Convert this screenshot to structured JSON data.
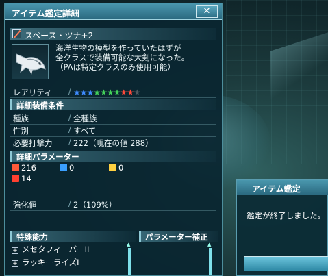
{
  "window": {
    "title": "アイテム鑑定詳細",
    "close_label": "✕"
  },
  "item": {
    "name": "スペース・ツナ+2",
    "description": [
      "海洋生物の模型を作っていたはずが",
      "全クラスで装備可能な大剣になった。",
      "（PAは特定クラスのみ使用可能）"
    ]
  },
  "rarity": {
    "label": "レアリティ",
    "stars_total": 10,
    "stars_filled": 9,
    "star_colors": [
      "#3f8cff",
      "#3f8cff",
      "#3f8cff",
      "#43d15a",
      "#43d15a",
      "#43d15a",
      "#43d15a",
      "#ff4a3a",
      "#ff4a3a",
      "#4e5a60"
    ]
  },
  "requirements": {
    "header": "詳細装備条件",
    "rows": [
      {
        "label": "種族",
        "value": "全種族"
      },
      {
        "label": "性別",
        "value": "すべて"
      },
      {
        "label": "必要打撃力",
        "value": "222（現在の値 288）"
      }
    ]
  },
  "parameters": {
    "header": "詳細パラメーター",
    "stats": [
      {
        "icon": "melee-attack-icon",
        "value": "216",
        "color": "#ff5a3a"
      },
      {
        "icon": "ranged-attack-icon",
        "value": "0",
        "color": "#3aa0ff"
      },
      {
        "icon": "tech-attack-icon",
        "value": "0",
        "color": "#ffd040"
      },
      {
        "icon": "fire-element-icon",
        "value": "14",
        "color": "#ff4030"
      }
    ]
  },
  "grind": {
    "label": "強化値",
    "value": "2（109%）"
  },
  "special": {
    "header": "特殊能力",
    "abilities": [
      "メセタフィーバーII",
      "ラッキーライズI"
    ]
  },
  "param_bonus": {
    "header": "パラメーター補正"
  },
  "identify_dialog": {
    "title": "アイテム鑑定",
    "message": "鑑定が終了しました。"
  }
}
